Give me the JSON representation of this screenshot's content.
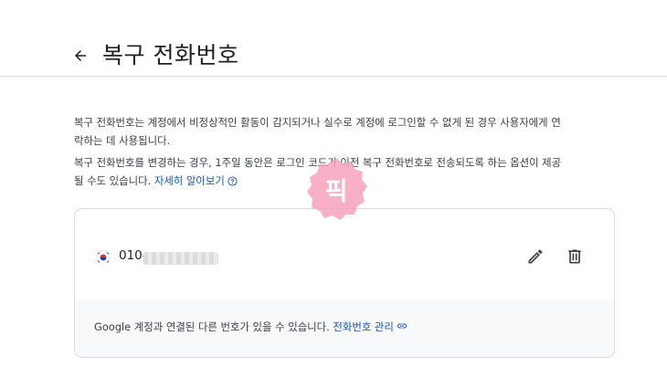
{
  "header": {
    "back_icon": "arrow-left-icon",
    "title": "복구 전화번호"
  },
  "description": {
    "paragraph1_line1": "복구 전화번호는 계정에서 비정상적인 활동이 감지되거나 실수로 계정에 로그인할 수 없게 된 경우 사용자에게 연",
    "paragraph1_line2": "락하는 데 사용됩니다.",
    "paragraph2_line1": "복구 전화번호를 변경하는 경우, 1주일 동안은 로그인 코드가 이전 복구 전화번호로 전송되도록 하는 옵션이 제공",
    "paragraph2_line2": "될 수도 있습니다.",
    "learn_more": "자세히 알아보기",
    "help_icon": "help-circle-icon"
  },
  "phone_card": {
    "country_flag": "korea-flag-icon",
    "phone_prefix": "010-",
    "edit_icon": "pencil-icon",
    "delete_icon": "trash-icon",
    "footer_text": "Google 계정과 연결된 다른 번호가 있을 수 있습니다.",
    "manage_link": "전화번호 관리",
    "manage_link_icon": "link-icon"
  },
  "watermark": {
    "text": "픽"
  },
  "colors": {
    "link": "#1a57a8",
    "border": "#dadce0",
    "footer_bg": "#f8f9fa",
    "watermark": "#f48fb1"
  }
}
